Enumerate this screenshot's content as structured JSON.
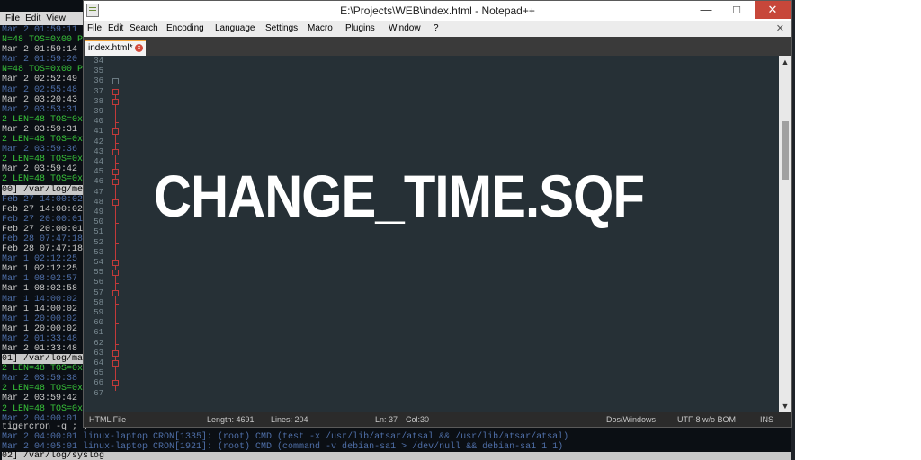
{
  "terminal": {
    "menu": [
      "File",
      "Edit",
      "View"
    ],
    "lines": [
      {
        "text": "Mar  2 01:59:11",
        "style": "dim"
      },
      {
        "text": "N=48 TOS=0x00 PREC",
        "style": "green"
      },
      {
        "text": "Mar  2 01:59:14",
        "style": "white"
      },
      {
        "text": "Mar  2 01:59:20",
        "style": "dim"
      },
      {
        "text": "N=48 TOS=0x00 PREC",
        "style": "green"
      },
      {
        "text": "Mar  2 02:52:49",
        "style": "white"
      },
      {
        "text": "Mar  2 02:55:48",
        "style": "dim"
      },
      {
        "text": "Mar  2 03:20:43",
        "style": "white"
      },
      {
        "text": "Mar  2 03:53:31",
        "style": "dim"
      },
      {
        "text": "2 LEN=48 TOS=0x0",
        "style": "green"
      },
      {
        "text": "Mar  2 03:59:31",
        "style": "white"
      },
      {
        "text": "2 LEN=48 TOS=0x0",
        "style": "green"
      },
      {
        "text": "Mar  2 03:59:36",
        "style": "dim"
      },
      {
        "text": "2 LEN=48 TOS=0x0",
        "style": "green"
      },
      {
        "text": "Mar  2 03:59:42",
        "style": "white"
      },
      {
        "text": "2 LEN=48 TOS=0x0",
        "style": "green"
      },
      {
        "text": "00] /var/log/mes",
        "style": "status"
      },
      {
        "text": "Feb 27 14:00:02",
        "style": "dim"
      },
      {
        "text": "Feb 27 14:00:02",
        "style": "white"
      },
      {
        "text": "Feb 27 20:00:01",
        "style": "dim"
      },
      {
        "text": "Feb 27 20:00:01",
        "style": "white"
      },
      {
        "text": "Feb 28 07:47:18",
        "style": "dim"
      },
      {
        "text": "Feb 28 07:47:18",
        "style": "white"
      },
      {
        "text": "Mar  1 02:12:25",
        "style": "dim"
      },
      {
        "text": "Mar  1 02:12:25",
        "style": "white"
      },
      {
        "text": "Mar  1 08:02:57",
        "style": "dim"
      },
      {
        "text": "Mar  1 08:02:58",
        "style": "white"
      },
      {
        "text": "Mar  1 14:00:02",
        "style": "dim"
      },
      {
        "text": "Mar  1 14:00:02",
        "style": "white"
      },
      {
        "text": "Mar  1 20:00:02",
        "style": "dim"
      },
      {
        "text": "Mar  1 20:00:02",
        "style": "white"
      },
      {
        "text": "Mar  2 01:33:48",
        "style": "dim"
      },
      {
        "text": "Mar  2 01:33:48",
        "style": "white"
      },
      {
        "text": "01] /var/log/mai",
        "style": "status"
      },
      {
        "text": "2 LEN=48 TOS=0x0",
        "style": "green"
      },
      {
        "text": "Mar  2 03:59:38",
        "style": "dim"
      },
      {
        "text": "2 LEN=48 TOS=0x0",
        "style": "green"
      },
      {
        "text": "Mar  2 03:59:42",
        "style": "white"
      },
      {
        "text": "2 LEN=48 TOS=0x0",
        "style": "green"
      },
      {
        "text": "Mar  2 04:00:01",
        "style": "dim"
      }
    ],
    "bottom": [
      "tigercron -q ; )",
      "Mar  2 04:00:01 linux-laptop CRON[1335]: (root) CMD (test -x /usr/lib/atsar/atsal && /usr/lib/atsar/atsal)",
      "Mar  2 04:05:01 linux-laptop CRON[1921]: (root) CMD (command -v debian-sa1 > /dev/null && debian-sa1 1 1)",
      "02] /var/log/syslog"
    ]
  },
  "window": {
    "title": "E:\\Projects\\WEB\\index.html - Notepad++",
    "controls": {
      "minimize": "—",
      "maximize": "□",
      "close": "✕"
    }
  },
  "menu": {
    "items": [
      "File",
      "Edit",
      "Search",
      "Encoding",
      "Language",
      "Settings",
      "Macro",
      "Plugins",
      "Window",
      "?"
    ],
    "close": "✕"
  },
  "tab": {
    "label": "index.html*",
    "close": "×"
  },
  "editor": {
    "line_numbers": [
      "34",
      "35",
      "36",
      "37",
      "38",
      "39",
      "40",
      "41",
      "42",
      "43",
      "44",
      "45",
      "46",
      "47",
      "48",
      "49",
      "50",
      "51",
      "52",
      "53",
      "54",
      "55",
      "56",
      "57",
      "58",
      "59",
      "60",
      "61",
      "62",
      "63",
      "64",
      "65",
      "66",
      "67"
    ],
    "overlay_title": "CHANGE_TIME.SQF"
  },
  "scrollbar": {
    "up": "▲",
    "down": "▼"
  },
  "status": {
    "file_type": "HTML File",
    "length": "Length: 4691",
    "lines": "Lines: 204",
    "ln": "Ln: 37",
    "col": "Col:30",
    "eol": "Dos\\Windows",
    "encoding": "UTF-8 w/o BOM",
    "mode": "INS"
  }
}
